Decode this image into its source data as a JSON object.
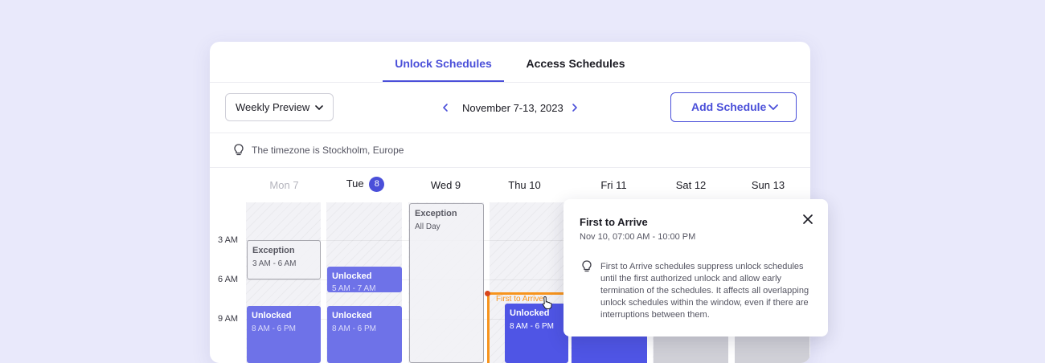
{
  "tabs": {
    "unlock": "Unlock Schedules",
    "access": "Access Schedules"
  },
  "toolbar": {
    "view_select": "Weekly Preview",
    "date_range": "November 7-13, 2023",
    "add_button": "Add Schedule"
  },
  "timezone": {
    "text": "The timezone is Stockholm, Europe"
  },
  "days": {
    "mon": "Mon 7",
    "tue": "Tue",
    "tue_badge": "8",
    "wed": "Wed 9",
    "thu": "Thu 10",
    "fri": "Fri 11",
    "sat": "Sat 12",
    "sun": "Sun 13"
  },
  "times": [
    "3 AM",
    "6 AM",
    "9 AM"
  ],
  "events": {
    "mon_exception": {
      "title": "Exception",
      "time": "3 AM - 6 AM"
    },
    "mon_unlocked": {
      "title": "Unlocked",
      "time": "8 AM - 6 PM"
    },
    "tue_unlocked_1": {
      "title": "Unlocked",
      "time": "5 AM - 7 AM"
    },
    "tue_unlocked_2": {
      "title": "Unlocked",
      "time": "8 AM - 6 PM"
    },
    "wed_exception": {
      "title": "Exception",
      "time": "All Day"
    },
    "thu_first_to_arrive": "First to Arrive",
    "thu_unlocked": {
      "title": "Unlocked",
      "time": "8 AM - 6 PM"
    }
  },
  "popover": {
    "title": "First to Arrive",
    "datetime": "Nov 10, 07:00 AM - 10:00 PM",
    "body": "First to Arrive schedules suppress unlock schedules until the first authorized unlock and allow early termination of the schedules. It affects all overlapping unlock schedules within the window, even if there are interruptions between them."
  },
  "icons": {
    "chevron_down": "chevron-down-icon",
    "chevron_left": "chevron-left-icon",
    "chevron_right": "chevron-right-icon",
    "lightbulb": "lightbulb-icon",
    "close": "close-icon",
    "pointer": "hand-pointer-icon"
  },
  "colors": {
    "accent": "#4a4fd9",
    "unlocked": "#6e72e8",
    "unlocked_dark": "#4f55e5",
    "first_to_arrive": "#f7941d",
    "background": "#e9e9fb"
  }
}
